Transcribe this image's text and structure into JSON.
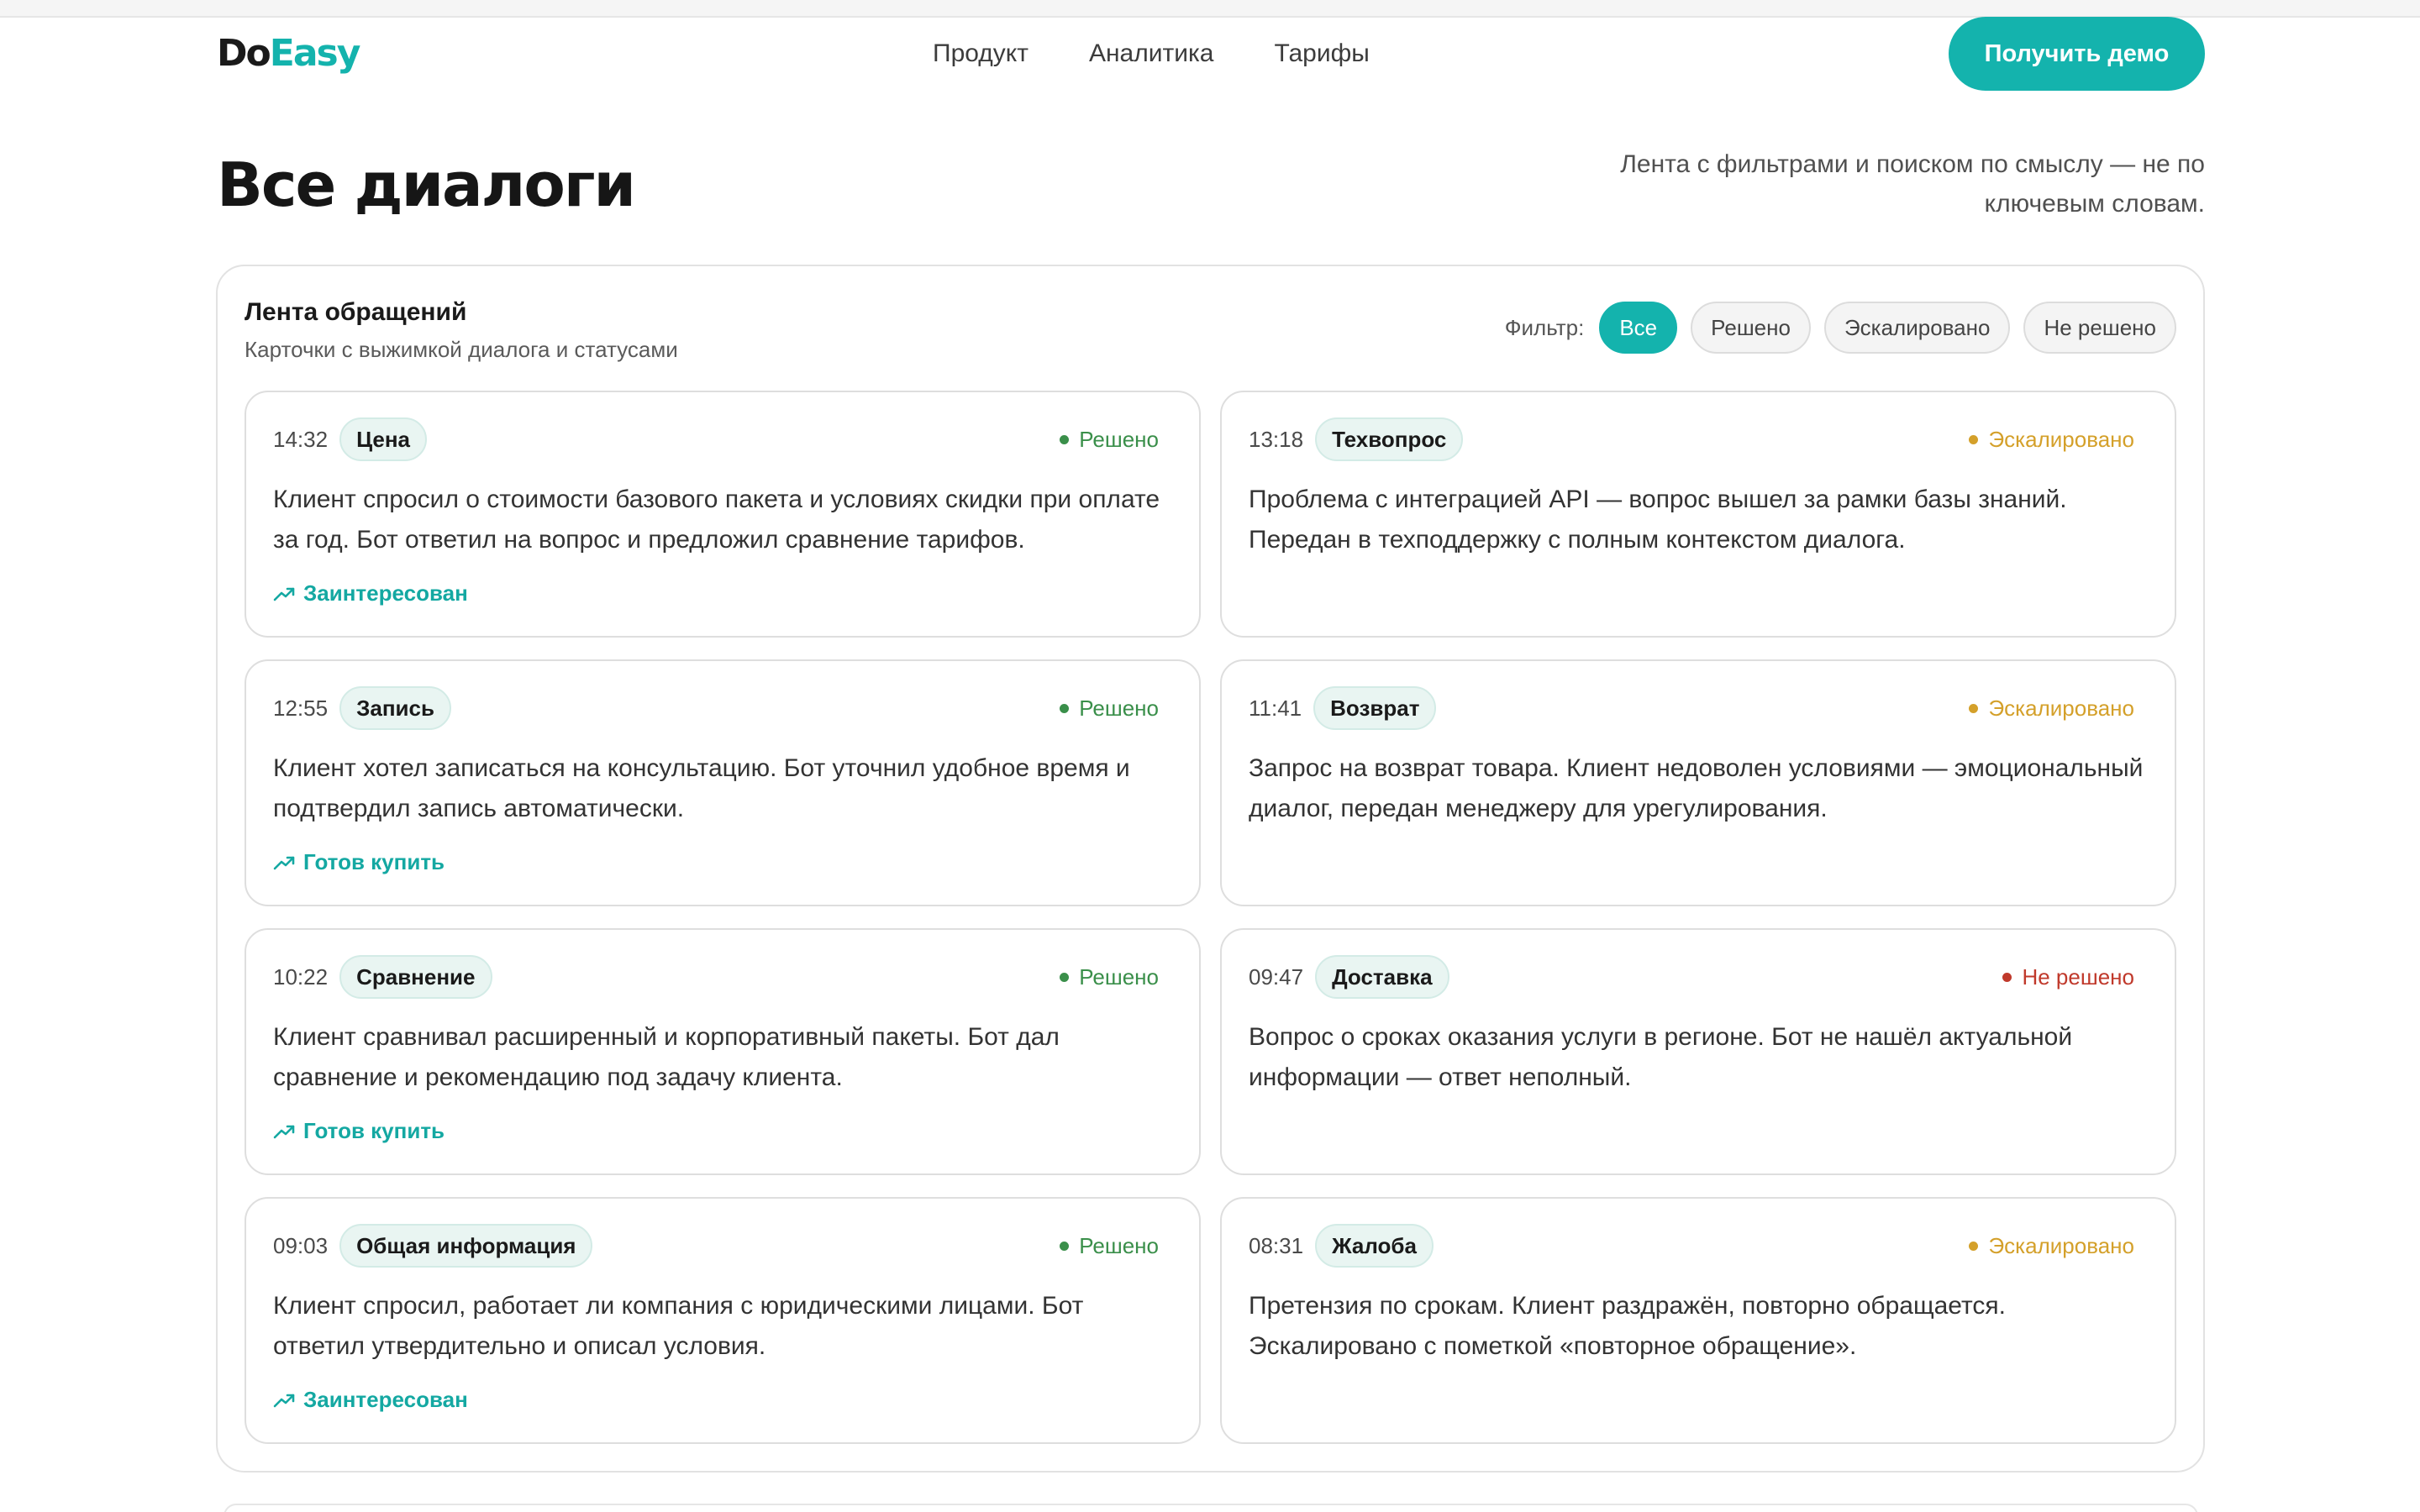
{
  "header": {
    "logo_do": "Do",
    "logo_easy": "Easy",
    "nav": [
      "Продукт",
      "Аналитика",
      "Тарифы"
    ],
    "demo_label": "Получить демо"
  },
  "page": {
    "title": "Все диалоги",
    "subtitle": "Лента с фильтрами и поиском по смыслу — не по ключевым словам."
  },
  "panel": {
    "title": "Лента обращений",
    "subtitle": "Карточки с выжимкой диалога и статусами",
    "filter_label": "Фильтр:",
    "filters": [
      "Все",
      "Решено",
      "Эскалировано",
      "Не решено"
    ],
    "active_filter": "Все"
  },
  "colors": {
    "accent": "#14b3ad",
    "solved": "#3a8f4a",
    "escalated": "#d4a02a",
    "unresolved": "#c0392b"
  },
  "cards": [
    {
      "time": "14:32",
      "tag": "Цена",
      "status": "Решено",
      "status_kind": "solved",
      "text": "Клиент спросил о стоимости базового пакета и условиях скидки при оплате за год. Бот ответил на вопрос и предложил сравнение тарифов.",
      "intent": "Заинтересован",
      "intent_icon": "trend-up-icon"
    },
    {
      "time": "13:18",
      "tag": "Техвопрос",
      "status": "Эскалировано",
      "status_kind": "escal",
      "text": "Проблема с интеграцией API — вопрос вышел за рамки базы знаний. Передан в техподдержку с полным контекстом диалога.",
      "intent": ""
    },
    {
      "time": "12:55",
      "tag": "Запись",
      "status": "Решено",
      "status_kind": "solved",
      "text": "Клиент хотел записаться на консультацию. Бот уточнил удобное время и подтвердил запись автоматически.",
      "intent": "Готов купить",
      "intent_icon": "trend-up-icon"
    },
    {
      "time": "11:41",
      "tag": "Возврат",
      "status": "Эскалировано",
      "status_kind": "escal",
      "text": "Запрос на возврат товара. Клиент недоволен условиями — эмоциональный диалог, передан менеджеру для урегулирования.",
      "intent": ""
    },
    {
      "time": "10:22",
      "tag": "Сравнение",
      "status": "Решено",
      "status_kind": "solved",
      "text": "Клиент сравнивал расширенный и корпоративный пакеты. Бот дал сравнение и рекомендацию под задачу клиента.",
      "intent": "Готов купить",
      "intent_icon": "trend-up-icon"
    },
    {
      "time": "09:47",
      "tag": "Доставка",
      "status": "Не решено",
      "status_kind": "unres",
      "text": "Вопрос о сроках оказания услуги в регионе. Бот не нашёл актуальной информации — ответ неполный.",
      "intent": ""
    },
    {
      "time": "09:03",
      "tag": "Общая информация",
      "status": "Решено",
      "status_kind": "solved",
      "text": "Клиент спросил, работает ли компания с юридическими лицами. Бот ответил утвердительно и описал условия.",
      "intent": "Заинтересован",
      "intent_icon": "trend-up-icon"
    },
    {
      "time": "08:31",
      "tag": "Жалоба",
      "status": "Эскалировано",
      "status_kind": "escal",
      "text": "Претензия по срокам. Клиент раздражён, повторно обращается. Эскалировано с пометкой «повторное обращение».",
      "intent": ""
    }
  ]
}
